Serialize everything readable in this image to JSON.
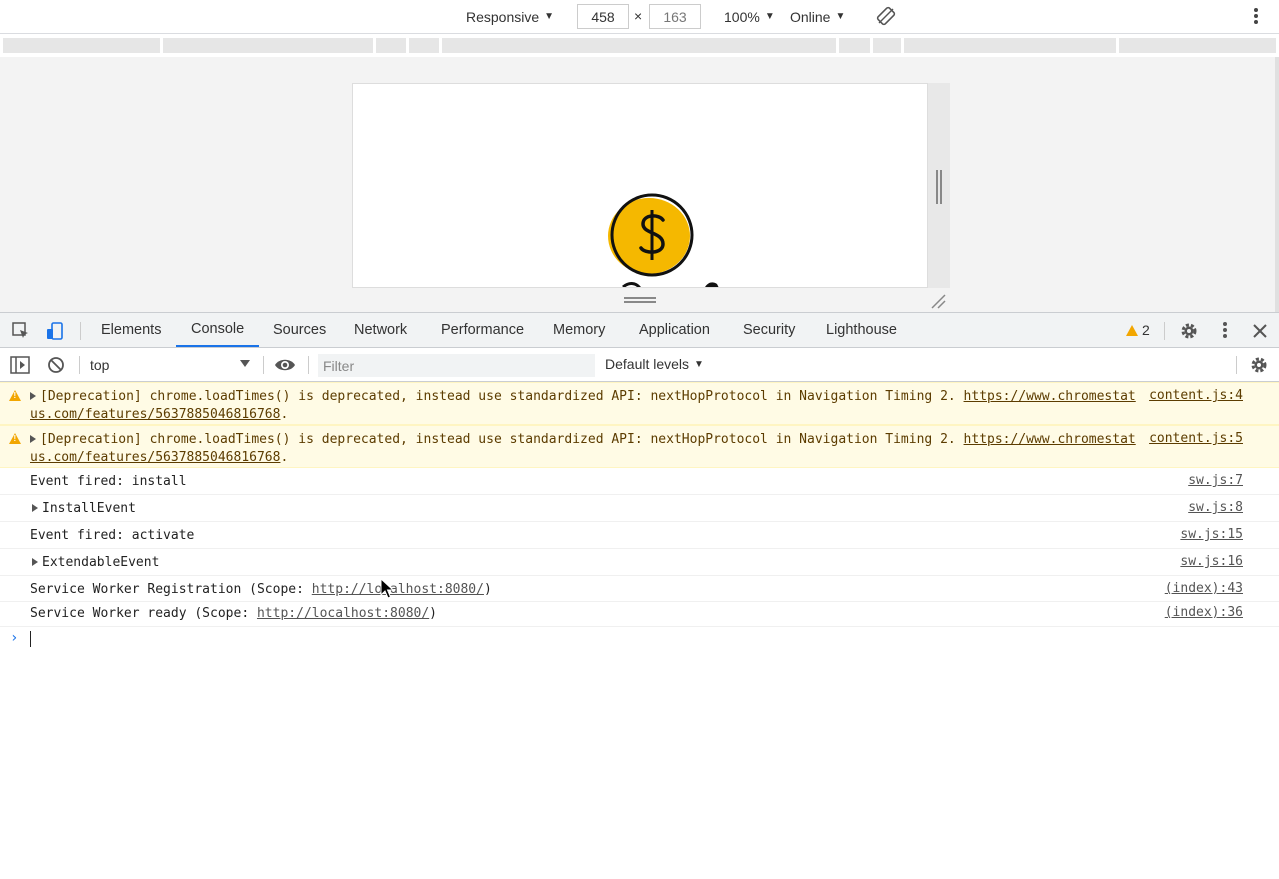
{
  "device_toolbar": {
    "device": "Responsive",
    "width": "458",
    "height": "163",
    "times": "×",
    "zoom": "100%",
    "network": "Online"
  },
  "tabs": [
    {
      "label": "Elements",
      "active": false
    },
    {
      "label": "Console",
      "active": true
    },
    {
      "label": "Sources",
      "active": false
    },
    {
      "label": "Network",
      "active": false
    },
    {
      "label": "Performance",
      "active": false
    },
    {
      "label": "Memory",
      "active": false
    },
    {
      "label": "Application",
      "active": false
    },
    {
      "label": "Security",
      "active": false
    },
    {
      "label": "Lighthouse",
      "active": false
    }
  ],
  "warning_count": "2",
  "console_toolbar": {
    "context": "top",
    "filter_placeholder": "Filter",
    "levels": "Default levels"
  },
  "messages": [
    {
      "type": "warning",
      "expandable": true,
      "text": "[Deprecation] chrome.loadTimes() is deprecated, instead use standardized API: nextHopProtocol in Navigation Timing 2. ",
      "url": "https://www.chromestatus.com/features/5637885046816768",
      "suffix": ".",
      "source": "content.js:4"
    },
    {
      "type": "warning",
      "expandable": true,
      "text": "[Deprecation] chrome.loadTimes() is deprecated, instead use standardized API: nextHopProtocol in Navigation Timing 2. ",
      "url": "https://www.chromestatus.com/features/5637885046816768",
      "suffix": ".",
      "source": "content.js:5"
    },
    {
      "type": "log",
      "expandable": false,
      "text": "Event fired: install",
      "source": "sw.js:7"
    },
    {
      "type": "log",
      "expandable": true,
      "text": "InstallEvent",
      "source": "sw.js:8"
    },
    {
      "type": "log",
      "expandable": false,
      "text": "Event fired: activate",
      "source": "sw.js:15"
    },
    {
      "type": "log",
      "expandable": true,
      "text": "ExtendableEvent",
      "source": "sw.js:16"
    },
    {
      "type": "log",
      "expandable": false,
      "text": "Service Worker Registration (Scope: ",
      "url": "http://localhost:8080/",
      "suffix": ")",
      "source": "(index):43"
    },
    {
      "type": "log",
      "expandable": false,
      "text": "Service Worker ready (Scope: ",
      "url": "http://localhost:8080/",
      "suffix": ")",
      "source": "(index):36"
    }
  ],
  "colors": {
    "accent": "#1a73e8",
    "warning_bg": "#fffbe5",
    "warning_text": "#5c3c00",
    "warning_icon": "#f2a600",
    "coin": "#f5b800"
  }
}
